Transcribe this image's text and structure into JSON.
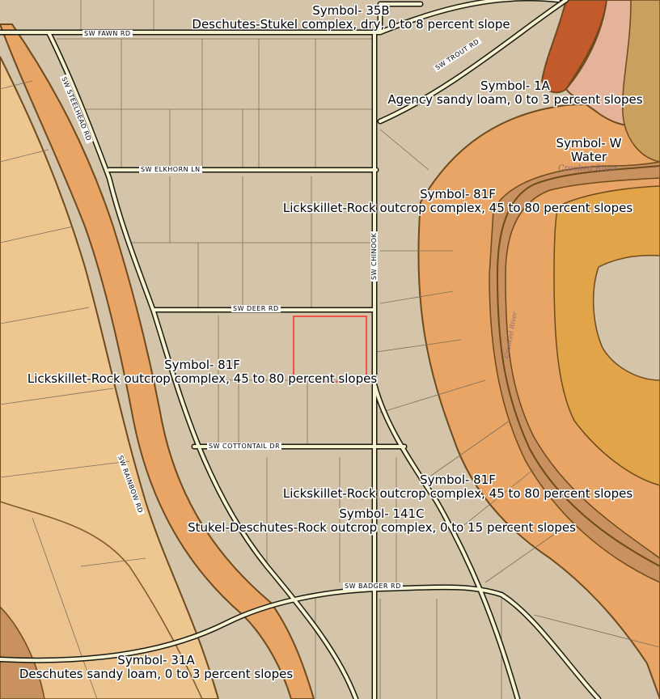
{
  "map": {
    "colors": {
      "background": "#d4c4aa",
      "soil_81F_light": "#eec690",
      "soil_81F_mid": "#e9a565",
      "soil_31A": "#ecc28f",
      "soil_1A": "#c25a2c",
      "soil_W": "#e5b29a",
      "soil_35B": "#c9a05e",
      "canyon": "#c8915f",
      "inner_plateau": "#e2a448",
      "road": "#f7f3d2",
      "road_edge": "#1a1a10",
      "soil_border": "#6e4a1c",
      "selection": "#ff2a2a"
    },
    "soil_labels": [
      {
        "symbol": "Symbol- 35B",
        "name": "Deschutes-Stukel complex, dry, 0 to 8 percent slope"
      },
      {
        "symbol": "Symbol- 1A",
        "name": "Agency sandy loam, 0 to 3 percent slopes"
      },
      {
        "symbol": "Symbol- W",
        "name": "Water"
      },
      {
        "symbol": "Symbol- 81F",
        "name": "Lickskillet-Rock outcrop complex, 45 to 80 percent slopes"
      },
      {
        "symbol": "Symbol- 81F",
        "name": "Lickskillet-Rock outcrop complex, 45 to 80 percent slopes"
      },
      {
        "symbol": "Symbol- 81F",
        "name": "Lickskillet-Rock outcrop complex, 45 to 80 percent slopes"
      },
      {
        "symbol": "Symbol- 141C",
        "name": "Stukel-Deschutes-Rock outcrop complex, 0 to 15 percent slopes"
      },
      {
        "symbol": "Symbol- 31A",
        "name": "Deschutes sandy loam, 0 to 3 percent slopes"
      }
    ],
    "road_labels": {
      "fawn": "SW FAWN RD",
      "trout": "SW TROUT RD",
      "steelhead": "SW STEELHEAD RD",
      "elkhorn": "SW ELKHORN LN",
      "chinook": "SW CHINOOK",
      "deer": "SW DEER RD",
      "cottontail": "SW COTTONTAIL DR",
      "rainbow": "SW RAINBOW RD",
      "badger": "SW BADGER RD"
    },
    "water_labels": {
      "crooked_river_1": "Crooked River",
      "crooked_river_2": "Crooked River"
    }
  }
}
